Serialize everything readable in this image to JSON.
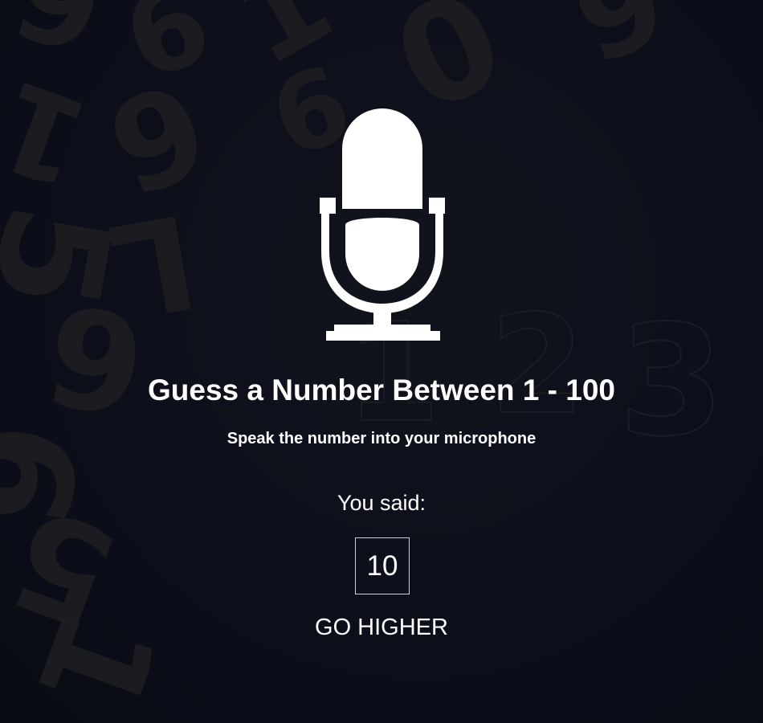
{
  "app": {
    "title": "Guess a Number Between 1 - 100",
    "instruction": "Speak the number into your microphone"
  },
  "result": {
    "label": "You said:",
    "spoken_number": "10",
    "hint": "GO HIGHER"
  },
  "icons": {
    "main": "microphone-icon"
  },
  "colors": {
    "background": "#0c0f1a",
    "text": "#ffffff",
    "box_border": "#cfcfd4"
  }
}
